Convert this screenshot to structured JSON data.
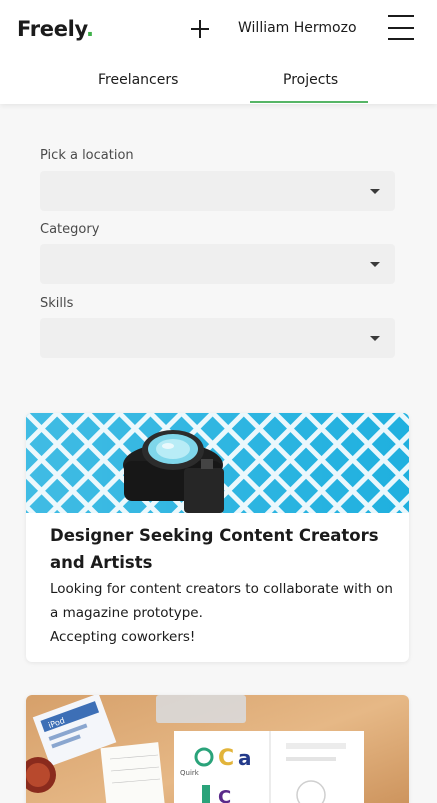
{
  "header": {
    "logo_text": "Freely",
    "logo_dot": ".",
    "user_name": "William Hermozo",
    "add_icon": "plus-icon",
    "menu_icon": "hamburger-icon",
    "accent_color": "#3fb04a"
  },
  "tabs": [
    {
      "label": "Freelancers",
      "active": false
    },
    {
      "label": "Projects",
      "active": true
    }
  ],
  "filters": [
    {
      "label": "Pick a location",
      "value": ""
    },
    {
      "label": "Category",
      "value": ""
    },
    {
      "label": "Skills",
      "value": ""
    }
  ],
  "projects": [
    {
      "title": "Designer Seeking Content Creators and Artists",
      "description_line1": "Looking for content creators to collaborate with on a magazine prototype.",
      "description_line2": "Accepting coworkers!"
    },
    {
      "title": "",
      "image_text_device": "iPod",
      "image_text_book_1": "Quirk"
    }
  ]
}
